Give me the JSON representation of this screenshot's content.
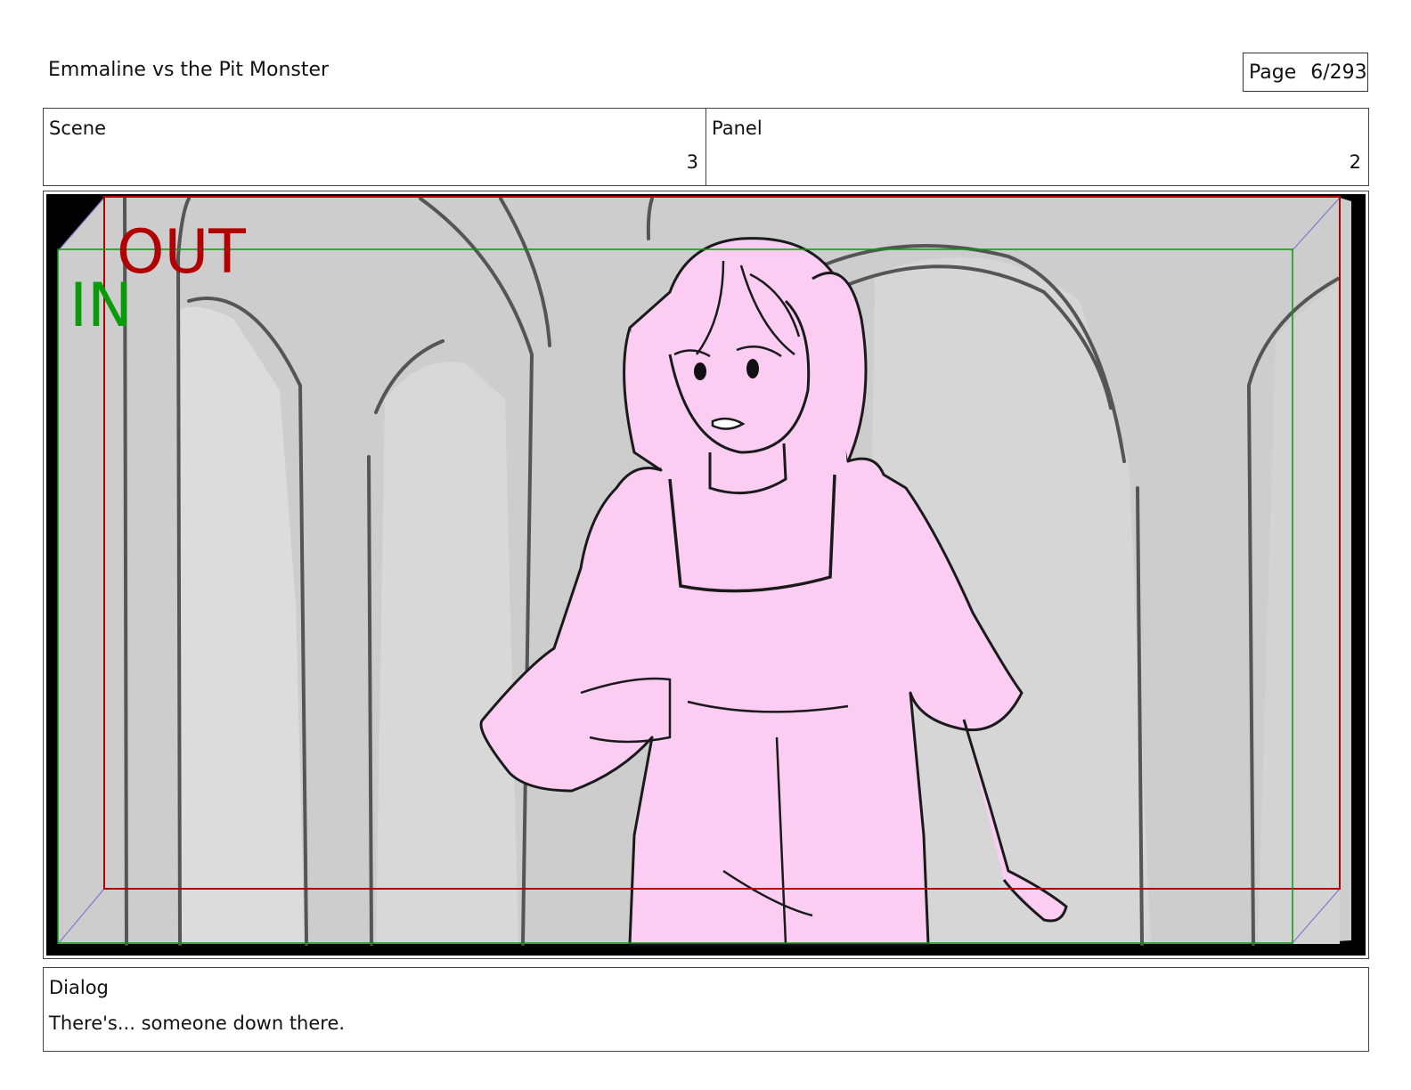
{
  "header": {
    "title": "Emmaline vs the Pit Monster",
    "page_label": "Page",
    "page_number": "6/293"
  },
  "info": {
    "scene_label": "Scene",
    "scene_value": "3",
    "panel_label": "Panel",
    "panel_value": "2"
  },
  "frame": {
    "safe_out_label": "OUT",
    "safe_in_label": "IN",
    "colors": {
      "out_guide": "#b00000",
      "in_guide": "#0a9a0a",
      "background": "#cfcfcf",
      "character_fill": "#fbcdf3",
      "line": "#1a1a1a"
    }
  },
  "dialog": {
    "label": "Dialog",
    "text": "There's... someone down there."
  }
}
